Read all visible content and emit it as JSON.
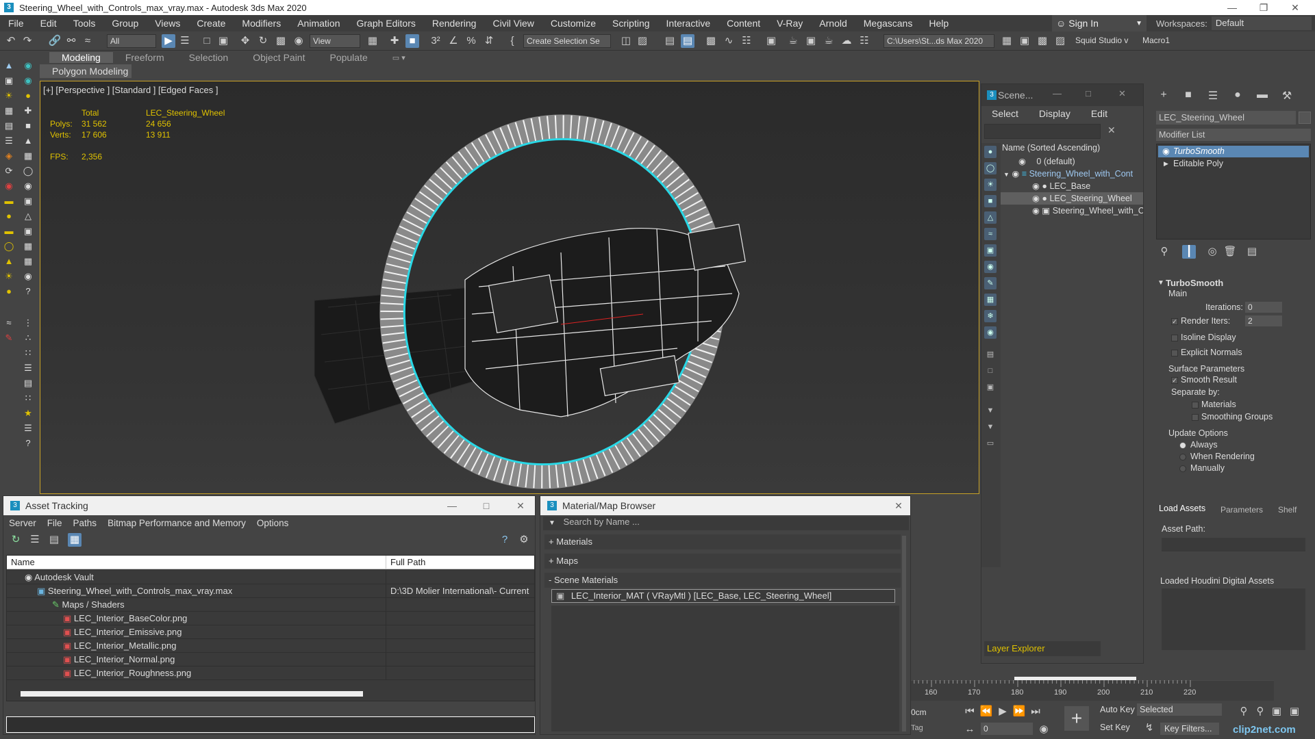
{
  "window": {
    "title": "Steering_Wheel_with_Controls_max_vray.max - Autodesk 3ds Max 2020",
    "app_icon": "3"
  },
  "menu": [
    "File",
    "Edit",
    "Tools",
    "Group",
    "Views",
    "Create",
    "Modifiers",
    "Animation",
    "Graph Editors",
    "Rendering",
    "Civil View",
    "Customize",
    "Scripting",
    "Interactive",
    "Content",
    "V-Ray",
    "Arnold",
    "Megascans",
    "Help"
  ],
  "signin": "Sign In",
  "workspaces": {
    "label": "Workspaces:",
    "value": "Default"
  },
  "toolbar": {
    "filter": "All",
    "ref_coord": "View",
    "selection_set": "Create Selection Se",
    "path": "C:\\Users\\St...ds Max 2020",
    "squid": "Squid Studio v",
    "macro": "Macro1"
  },
  "ribbon": {
    "tabs": [
      "Modeling",
      "Freeform",
      "Selection",
      "Object Paint",
      "Populate"
    ],
    "active": "Modeling",
    "sub": "Polygon Modeling"
  },
  "viewport": {
    "label": "[+] [Perspective ] [Standard ] [Edged Faces ]",
    "stats": {
      "total": "Total",
      "object": "LEC_Steering_Wheel",
      "polys_label": "Polys:",
      "polys_total": "31 562",
      "polys_obj": "24 656",
      "verts_label": "Verts:",
      "verts_total": "17 606",
      "verts_obj": "13 911",
      "fps_label": "FPS:",
      "fps": "2,356"
    },
    "colors": {
      "selection_outline": "#29d8e6",
      "wire": "#ffffff",
      "frame": "#c9a227"
    }
  },
  "scene_explorer": {
    "title": "Scene...",
    "menu": [
      "Select",
      "Display",
      "Edit"
    ],
    "column": "Name (Sorted Ascending)",
    "rows": [
      {
        "name": "0 (default)",
        "indent": 1
      },
      {
        "name": "Steering_Wheel_with_Cont",
        "indent": 0,
        "expanded": true
      },
      {
        "name": "LEC_Base",
        "indent": 2
      },
      {
        "name": "LEC_Steering_Wheel",
        "indent": 2,
        "selected": true
      },
      {
        "name": "Steering_Wheel_with_C",
        "indent": 2
      }
    ],
    "footer": "Layer Explorer"
  },
  "command_panel": {
    "object_name": "LEC_Steering_Wheel",
    "modifier_list": "Modifier List",
    "stack": [
      {
        "name": "TurboSmooth",
        "selected": true
      },
      {
        "name": "Editable Poly",
        "selected": false
      }
    ],
    "rollout": {
      "title": "TurboSmooth",
      "main": "Main",
      "iterations_label": "Iterations:",
      "iterations": "0",
      "render_iters_label": "Render Iters:",
      "render_iters": "2",
      "isoline": "Isoline Display",
      "explicit": "Explicit Normals",
      "surface": "Surface Parameters",
      "smooth": "Smooth Result",
      "separate": "Separate by:",
      "materials": "Materials",
      "smoothing": "Smoothing Groups",
      "update": "Update Options",
      "always": "Always",
      "when_rendering": "When Rendering",
      "manually": "Manually"
    }
  },
  "houdini": {
    "tabs": [
      "Load Assets",
      "Parameters",
      "Shelf"
    ],
    "asset_path": "Asset Path:",
    "loaded": "Loaded Houdini Digital Assets"
  },
  "asset_tracking": {
    "title": "Asset Tracking",
    "menu": [
      "Server",
      "File",
      "Paths",
      "Bitmap Performance and Memory",
      "Options"
    ],
    "columns": [
      "Name",
      "Full Path"
    ],
    "rows": [
      {
        "name": "Autodesk Vault",
        "path": "",
        "indent": 0
      },
      {
        "name": "Steering_Wheel_with_Controls_max_vray.max",
        "path": "D:\\3D Molier International\\- Current",
        "indent": 1
      },
      {
        "name": "Maps / Shaders",
        "path": "",
        "indent": 2
      },
      {
        "name": "LEC_Interior_BaseColor.png",
        "path": "",
        "indent": 3
      },
      {
        "name": "LEC_Interior_Emissive.png",
        "path": "",
        "indent": 3
      },
      {
        "name": "LEC_Interior_Metallic.png",
        "path": "",
        "indent": 3
      },
      {
        "name": "LEC_Interior_Normal.png",
        "path": "",
        "indent": 3
      },
      {
        "name": "LEC_Interior_Roughness.png",
        "path": "",
        "indent": 3
      }
    ]
  },
  "material_browser": {
    "title": "Material/Map Browser",
    "search": "Search by Name ...",
    "sections": [
      "+ Materials",
      "+ Maps",
      "- Scene Materials"
    ],
    "item": "LEC_Interior_MAT  ( VRayMtl ) [LEC_Base, LEC_Steering_Wheel]"
  },
  "timeline": {
    "ticks": [
      "160",
      "170",
      "180",
      "190",
      "200",
      "210",
      "220"
    ]
  },
  "anim_controls": {
    "auto_key": "Auto Key",
    "set_key": "Set Key",
    "selected": "Selected",
    "key_filters": "Key Filters...",
    "frame": "0",
    "cm": "0cm",
    "tag": "Tag"
  },
  "watermark": "clip2net.com"
}
